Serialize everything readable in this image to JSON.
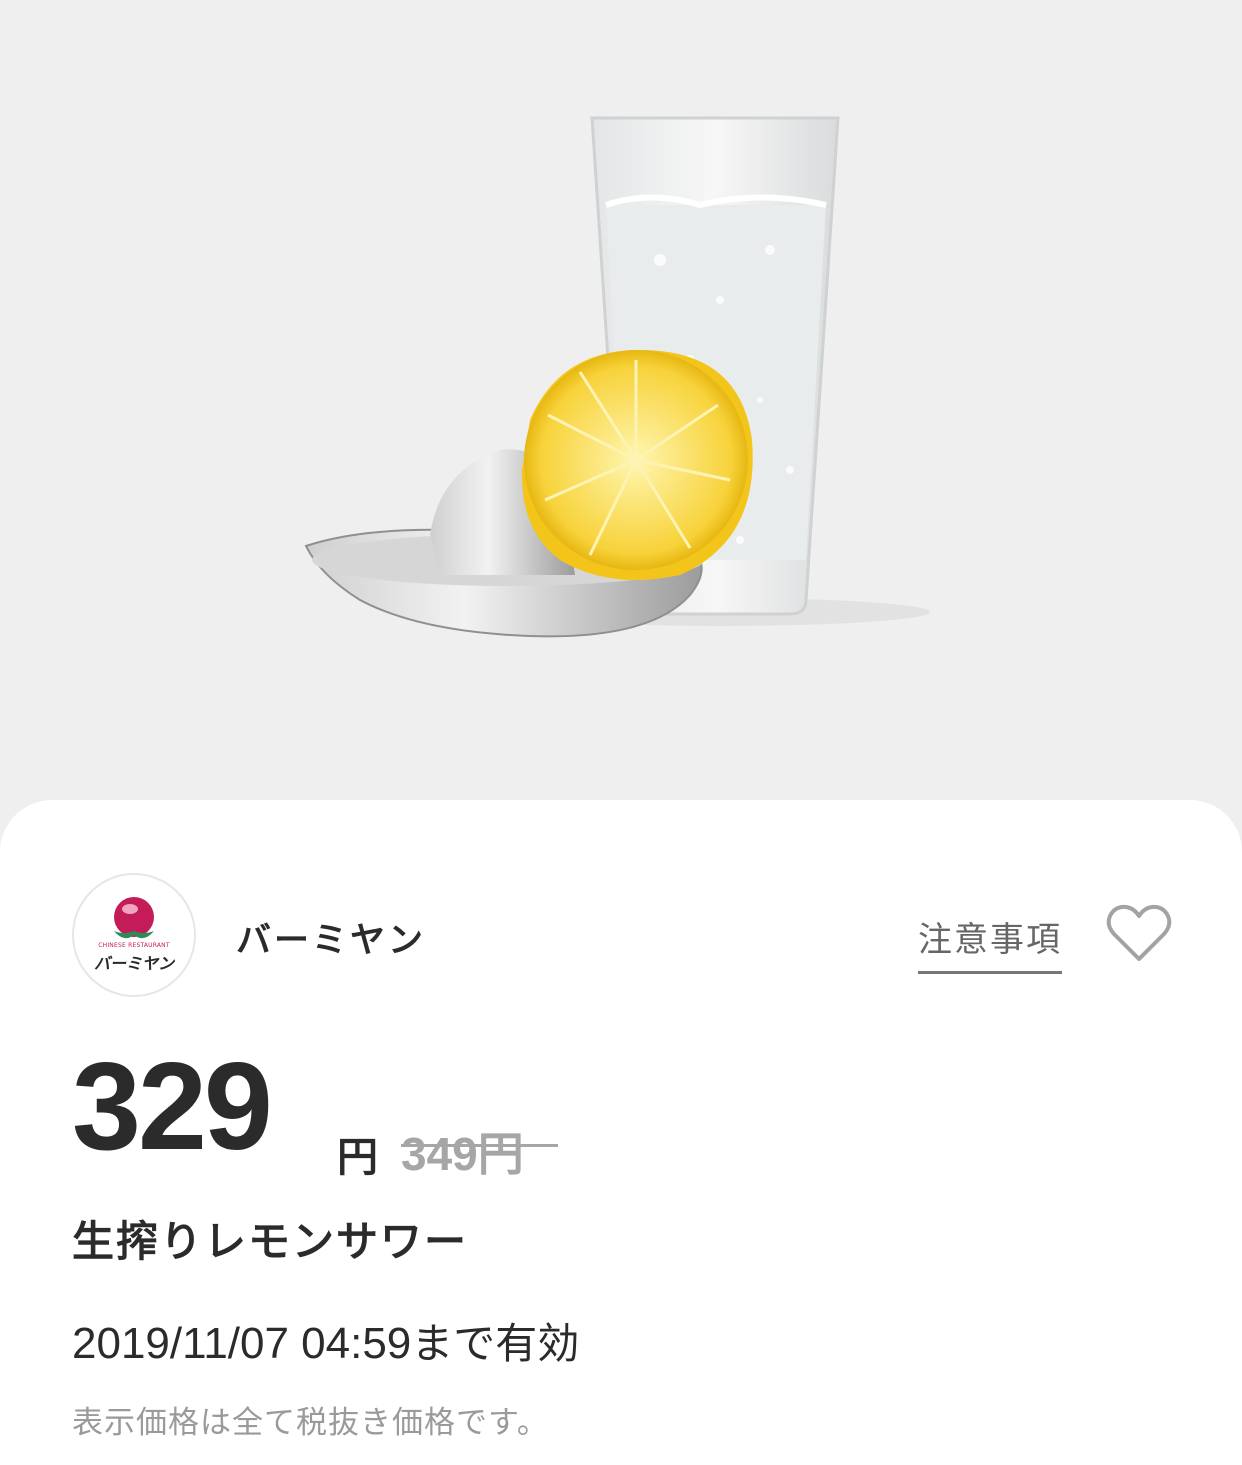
{
  "brand": {
    "name": "バーミヤン",
    "logo_caption": "CHINESE RESTAURANT",
    "logo_kana": "バーミヤン",
    "logo_color": "#c41c59"
  },
  "header": {
    "notes_label": "注意事項",
    "favorite_icon": "heart-outline-icon"
  },
  "product": {
    "price": "329",
    "currency": "円",
    "original_price": "349円",
    "name": "生搾りレモンサワー"
  },
  "validity": {
    "datetime": "2019/11/07 04:59",
    "suffix": "まで有効"
  },
  "tax_note": "表示価格は全て税抜き価格です。"
}
